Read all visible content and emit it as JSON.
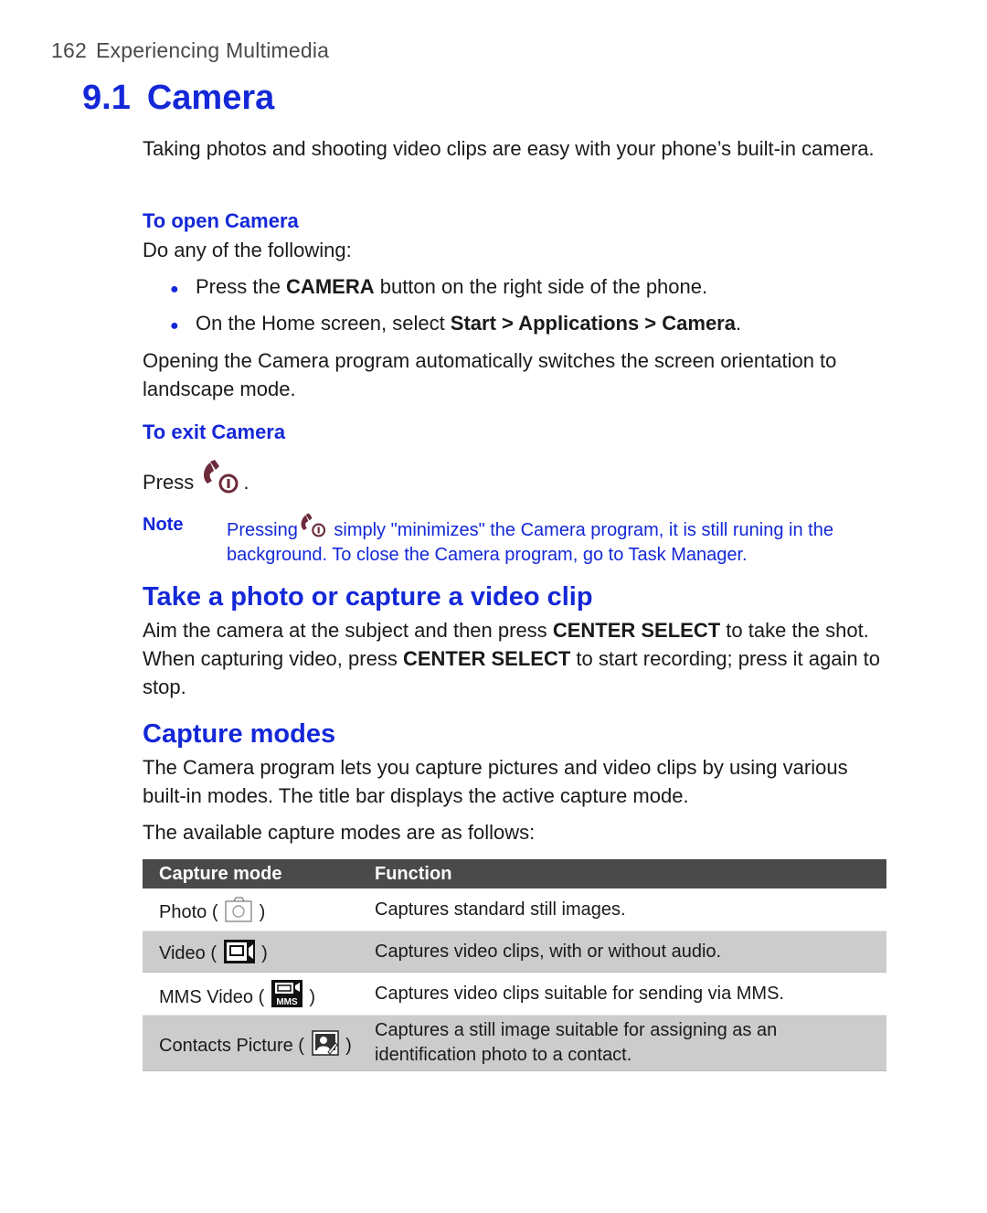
{
  "header": {
    "page_number": "162",
    "chapter_name": "Experiencing Multimedia"
  },
  "chapter": {
    "number": "9.1",
    "title": "Camera"
  },
  "intro": "Taking photos and shooting video clips are easy with your phone’s built-in camera.",
  "open_camera": {
    "heading": "To open Camera",
    "lead": "Do any of the following:",
    "bullets": [
      {
        "pre": "Press the ",
        "bold": "CAMERA",
        "post": " button on the right side of the phone."
      },
      {
        "pre": "On the Home screen, select ",
        "bold": "Start > Applications > Camera",
        "post": "."
      }
    ],
    "after": "Opening the Camera program automatically switches the screen orientation to landscape mode."
  },
  "exit_camera": {
    "heading": "To exit Camera",
    "press_label": "Press",
    "press_suffix": ".",
    "icon": "end-call-icon"
  },
  "note": {
    "label": "Note",
    "pre": "Pressing",
    "post": " simply \"minimizes\" the Camera program, it is still runing in the",
    "line2": "background. To close the Camera program, go to Task Manager."
  },
  "take_photo": {
    "heading": "Take a photo or capture a video clip",
    "p_a": "Aim the camera at the subject and then press ",
    "b_a": "CENTER SELECT",
    "p_b": " to take the shot. When capturing video, press ",
    "b_b": "CENTER SELECT",
    "p_c": " to start recording; press it again to stop."
  },
  "capture_modes": {
    "heading": "Capture modes",
    "p1": "The Camera program lets you capture pictures and video clips by using various built-in modes. The title bar displays the active capture mode.",
    "p2": "The available capture modes are as follows:",
    "table": {
      "columns": [
        "Capture mode",
        "Function"
      ],
      "rows": [
        {
          "mode": "Photo",
          "icon": "photo-mode-icon",
          "function": "Captures standard still images."
        },
        {
          "mode": "Video",
          "icon": "video-mode-icon",
          "function": "Captures video clips, with or without audio."
        },
        {
          "mode": "MMS Video",
          "icon": "mms-video-mode-icon",
          "function": "Captures video clips suitable for sending via MMS."
        },
        {
          "mode": "Contacts Picture",
          "icon": "contacts-picture-mode-icon",
          "function_line1": "Captures a still image suitable for assigning as an",
          "function_line2": "identification photo to a contact."
        }
      ]
    }
  },
  "colors": {
    "accent_blue": "#1428d8",
    "table_header_bg": "#4a4a4a",
    "table_alt_row_bg": "#cccccc",
    "end_key_icon": "#6b2b3a"
  },
  "punct": {
    "open": " ( ",
    "close": " )"
  }
}
